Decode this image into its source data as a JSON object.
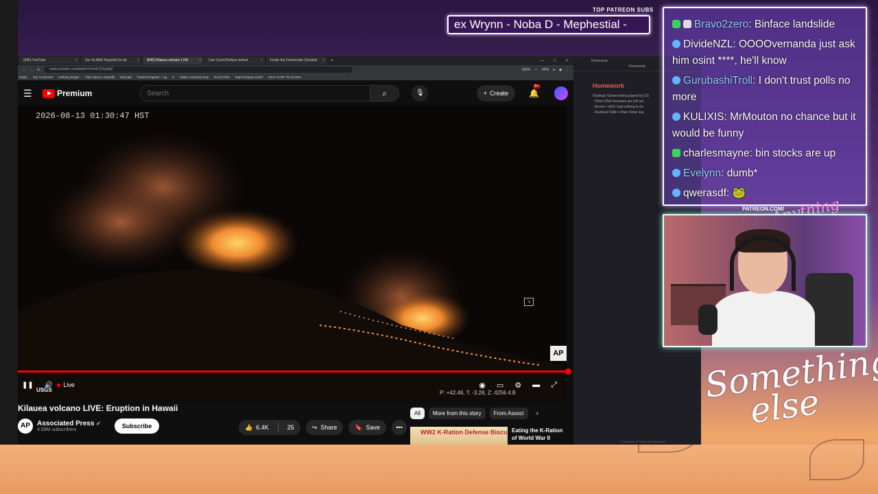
{
  "browser": {
    "tabs": [
      {
        "label": "(845) YouTube",
        "active": false
      },
      {
        "label": "Joe SLAMS Hegseth for ab",
        "active": false
      },
      {
        "label": "(845) Kilauea volcano LIVE",
        "active": true
      },
      {
        "label": "Can Count Binface defeat",
        "active": false
      },
      {
        "label": "Inside the Democratic Socialist",
        "active": false
      }
    ],
    "url": "www.youtube.com/watch?v=mK7Z1ysbjQ",
    "zoom": "150%",
    "vpn": "VPN",
    "bookmarks": [
      "Radio",
      "Top 10 Memes",
      "Nothing Burger",
      "Clair Obscur: Expediti",
      "New tab",
      "Podomi Register :: Ag",
      "X",
      "Native American Day",
      "ELECTION",
      "https://simpar.com/P",
      "WHY SLOP TO LEARN"
    ]
  },
  "youtube": {
    "logo_text": "Premium",
    "search_placeholder": "Search",
    "create_label": "Create",
    "notification_count": "9+",
    "player": {
      "timestamp": "2026-08-13 01:30:47 HST",
      "live_label": "Live",
      "coords": "P: +42.46, T: -3.28, Z: 4256 4.8",
      "usgs": "USGS",
      "ap_badge": "AP"
    },
    "video_title": "Kilauea volcano LIVE: Eruption in Hawaii",
    "channel": {
      "logo": "AP",
      "name": "Associated Press",
      "verified": "✔",
      "subscribers": "4.59M subscribers",
      "subscribe_label": "Subscribe"
    },
    "actions": {
      "likes": "6.4K",
      "dislikes": "25",
      "share": "Share",
      "save": "Save",
      "more": "•••"
    },
    "chips": [
      "All",
      "More from this story",
      "From Associ"
    ],
    "recommendation": {
      "thumb_text": "WW2 K-Ration Defense Biscuits",
      "title": "Eating the K-Ration of World War II"
    }
  },
  "notes": {
    "header": "Homework",
    "tab": "Homework",
    "title": "Homework",
    "lines": [
      "Strategic Games being played by DS",
      "· Other DSA members are left out",
      "· Bernie + AOC had nothing to do",
      "· Rasheed Talib + Ilhan Omar sup"
    ],
    "footer": "0 backlinks   31 words   167 characters"
  },
  "overlay": {
    "patreon_label": "TOP PATREON SUBS",
    "patreon_ticker": "ex Wrynn -  Noba D - Mephestial -",
    "cam_label": "PATREON.COM/",
    "cam_script": "Anything else?",
    "something_else_1": "Something",
    "something_else_2": "else"
  },
  "chat": [
    {
      "user": "Bravo2zero",
      "text": "Binface landslide",
      "badge_color": "#3bd35b",
      "user_color": "#8fd0ff"
    },
    {
      "user": "DivideNZL",
      "text": "OOOOvernanda just ask him osint ****, he'll know",
      "badge_color": "#5fb7ff",
      "user_color": "#ffffff"
    },
    {
      "user": "GurubashiTroll",
      "text": "I don't trust polls no more",
      "badge_color": "#5fb7ff",
      "user_color": "#8fd0ff"
    },
    {
      "user": "KULIXIS",
      "text": "MrMouton no chance but it would be funny",
      "badge_color": "#5fb7ff",
      "user_color": "#ffffff"
    },
    {
      "user": "charlesmayne",
      "text": "bin stocks are up",
      "badge_color": "#3bd35b",
      "user_color": "#ffffff"
    },
    {
      "user": "Evelynn",
      "text": "dumb*",
      "badge_color": "#5fb7ff",
      "user_color": "#8fd0ff"
    },
    {
      "user": "qwerasdf",
      "text": "",
      "badge_color": "#5fb7ff",
      "user_color": "#ffffff"
    }
  ],
  "colors": {
    "accent_red": "#ff0000",
    "chat_bg": "#6e46be"
  }
}
